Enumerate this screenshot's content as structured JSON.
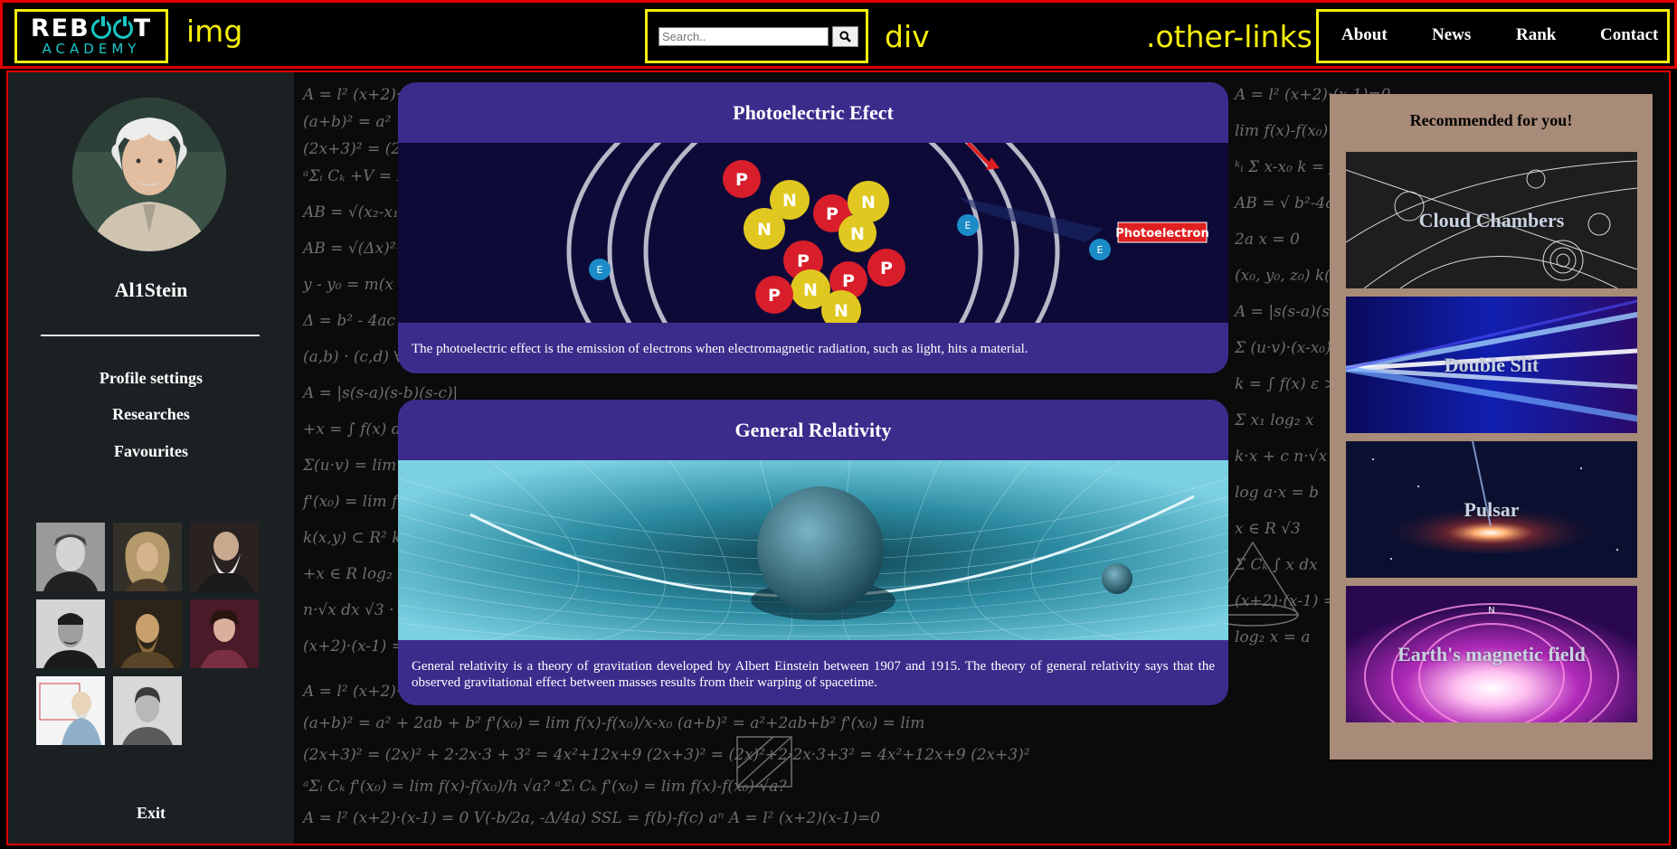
{
  "header": {
    "logo_top": "REBOOT",
    "logo_bottom": "ACADEMY",
    "debug_label_img": "img",
    "debug_label_div": "div",
    "debug_label_links": ".other-links",
    "search": {
      "placeholder": "Search..",
      "value": ""
    },
    "nav": [
      "About",
      "News",
      "Rank",
      "Contact"
    ]
  },
  "sidebar": {
    "username": "Al1Stein",
    "links": [
      "Profile settings",
      "Researches",
      "Favourites"
    ],
    "scientist_thumbnails": 8,
    "exit_label": "Exit"
  },
  "cards": [
    {
      "title": "Photoelectric Efect",
      "text": "The photoelectric effect is the emission of electrons when electromagnetic radiation, such as light, hits a material.",
      "image_label": "Photoelectron"
    },
    {
      "title": "General Relativity",
      "text": "General relativity is a theory of gravitation developed by Albert Einstein between 1907 and 1915. The theory of general relativity says that the observed gravitational effect between masses results from their warping of spacetime."
    }
  ],
  "recommended": {
    "title": "Recommended for you!",
    "items": [
      "Cloud Chambers",
      "Double Slit",
      "Pulsar",
      "Earth's magnetic field"
    ]
  },
  "colors": {
    "debug_outline": "#e00000",
    "debug_highlight": "#f5ee0c",
    "card_bg": "#3b2c8c",
    "sidebar_bg": "#1b2023",
    "recommended_bg": "#a88b78",
    "logo_accent": "#19c6c6"
  }
}
